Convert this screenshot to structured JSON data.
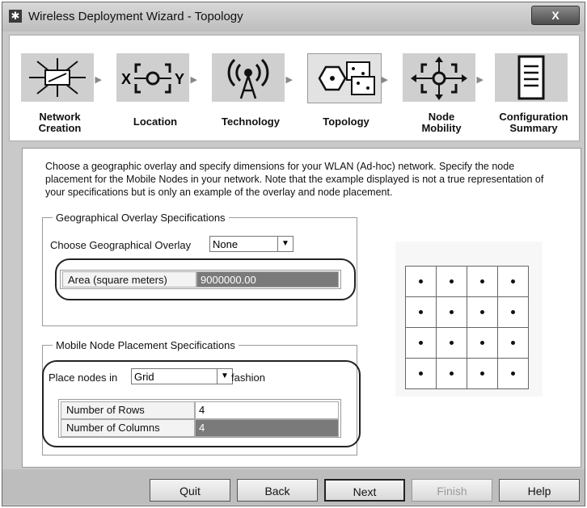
{
  "window": {
    "title": "Wireless Deployment Wizard - Topology",
    "close_label": "X"
  },
  "steps": [
    {
      "label_line1": "Network",
      "label_line2": "Creation",
      "icon": "network-creation-icon"
    },
    {
      "label_line1": "Location",
      "label_line2": "",
      "icon": "location-icon"
    },
    {
      "label_line1": "Technology",
      "label_line2": "",
      "icon": "technology-icon"
    },
    {
      "label_line1": "Topology",
      "label_line2": "",
      "icon": "topology-icon"
    },
    {
      "label_line1": "Node",
      "label_line2": "Mobility",
      "icon": "node-mobility-icon"
    },
    {
      "label_line1": "Configuration",
      "label_line2": "Summary",
      "icon": "configuration-summary-icon"
    }
  ],
  "description": "Choose a geographic overlay and specify dimensions for your WLAN (Ad-hoc) network. Specify the node placement for the Mobile Nodes in your network. Note that the example displayed is not a true representation of your specifications but is only an example of the overlay and node placement.",
  "geo": {
    "legend": "Geographical Overlay Specifications",
    "overlay_label": "Choose Geographical Overlay",
    "overlay_value": "None",
    "area_label": "Area (square meters)",
    "area_value": "9000000.00"
  },
  "mobile": {
    "legend": "Mobile Node Placement Specifications",
    "place_label": "Place nodes in",
    "place_value": "Grid",
    "fashion_label": "fashion",
    "rows_label": "Number of Rows",
    "rows_value": "4",
    "cols_label": "Number of Columns",
    "cols_value": "4"
  },
  "preview": {
    "grid_rows": 4,
    "grid_cols": 4
  },
  "buttons": {
    "quit": "Quit",
    "back": "Back",
    "next": "Next",
    "finish": "Finish",
    "help": "Help"
  }
}
